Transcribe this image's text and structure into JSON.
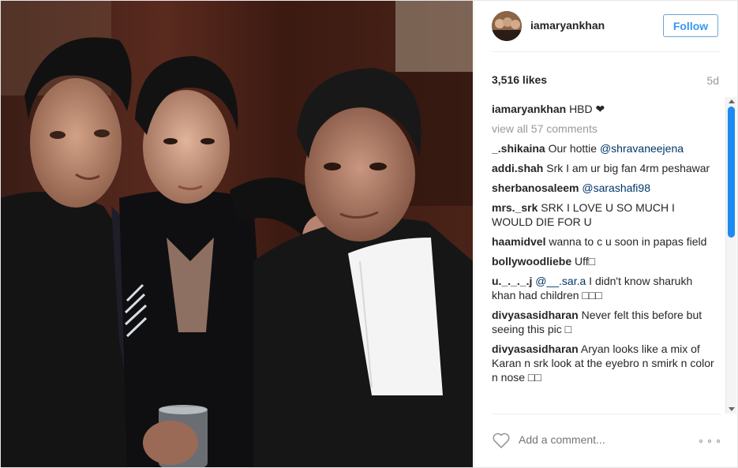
{
  "post": {
    "username": "iamaryankhan",
    "follow_label": "Follow",
    "likes": "3,516 likes",
    "time_ago": "5d",
    "caption": {
      "user": "iamaryankhan",
      "text": "HBD ❤"
    },
    "view_all": "view all 57 comments",
    "comments": [
      {
        "user": "_.shikaina",
        "text": "Our hottie ",
        "mention": "@shravaneejena"
      },
      {
        "user": "addi.shah",
        "text": "Srk I am ur big fan 4rm peshawar",
        "mention": ""
      },
      {
        "user": "sherbanosaleem",
        "text": "",
        "mention": "@sarashafi98"
      },
      {
        "user": "mrs._srk",
        "text": "SRK I LOVE U SO MUCH I WOULD DIE FOR U",
        "mention": ""
      },
      {
        "user": "haamidvel",
        "text": "wanna to c u soon in papas field",
        "mention": ""
      },
      {
        "user": "bollywoodliebe",
        "text": "Uff□",
        "mention": ""
      },
      {
        "user": "u._._._.j",
        "text": " I didn't know sharukh khan had children □□□",
        "mention": "@__.sar.a",
        "mention_first": true
      },
      {
        "user": "divyasasidharan",
        "text": "Never felt this before but seeing this pic □",
        "mention": ""
      },
      {
        "user": "divyasasidharan",
        "text": "Aryan looks like a mix of Karan n srk look at the eyebro n smirk n color n nose □□",
        "mention": ""
      }
    ],
    "add_comment_placeholder": "Add a comment..."
  },
  "icons": {
    "heart": "heart-outline-icon",
    "more": "more-options-icon"
  },
  "colors": {
    "follow_text": "#3897f0",
    "mention": "#003569",
    "muted": "#999999",
    "scroll_thumb": "#1d8af2"
  }
}
